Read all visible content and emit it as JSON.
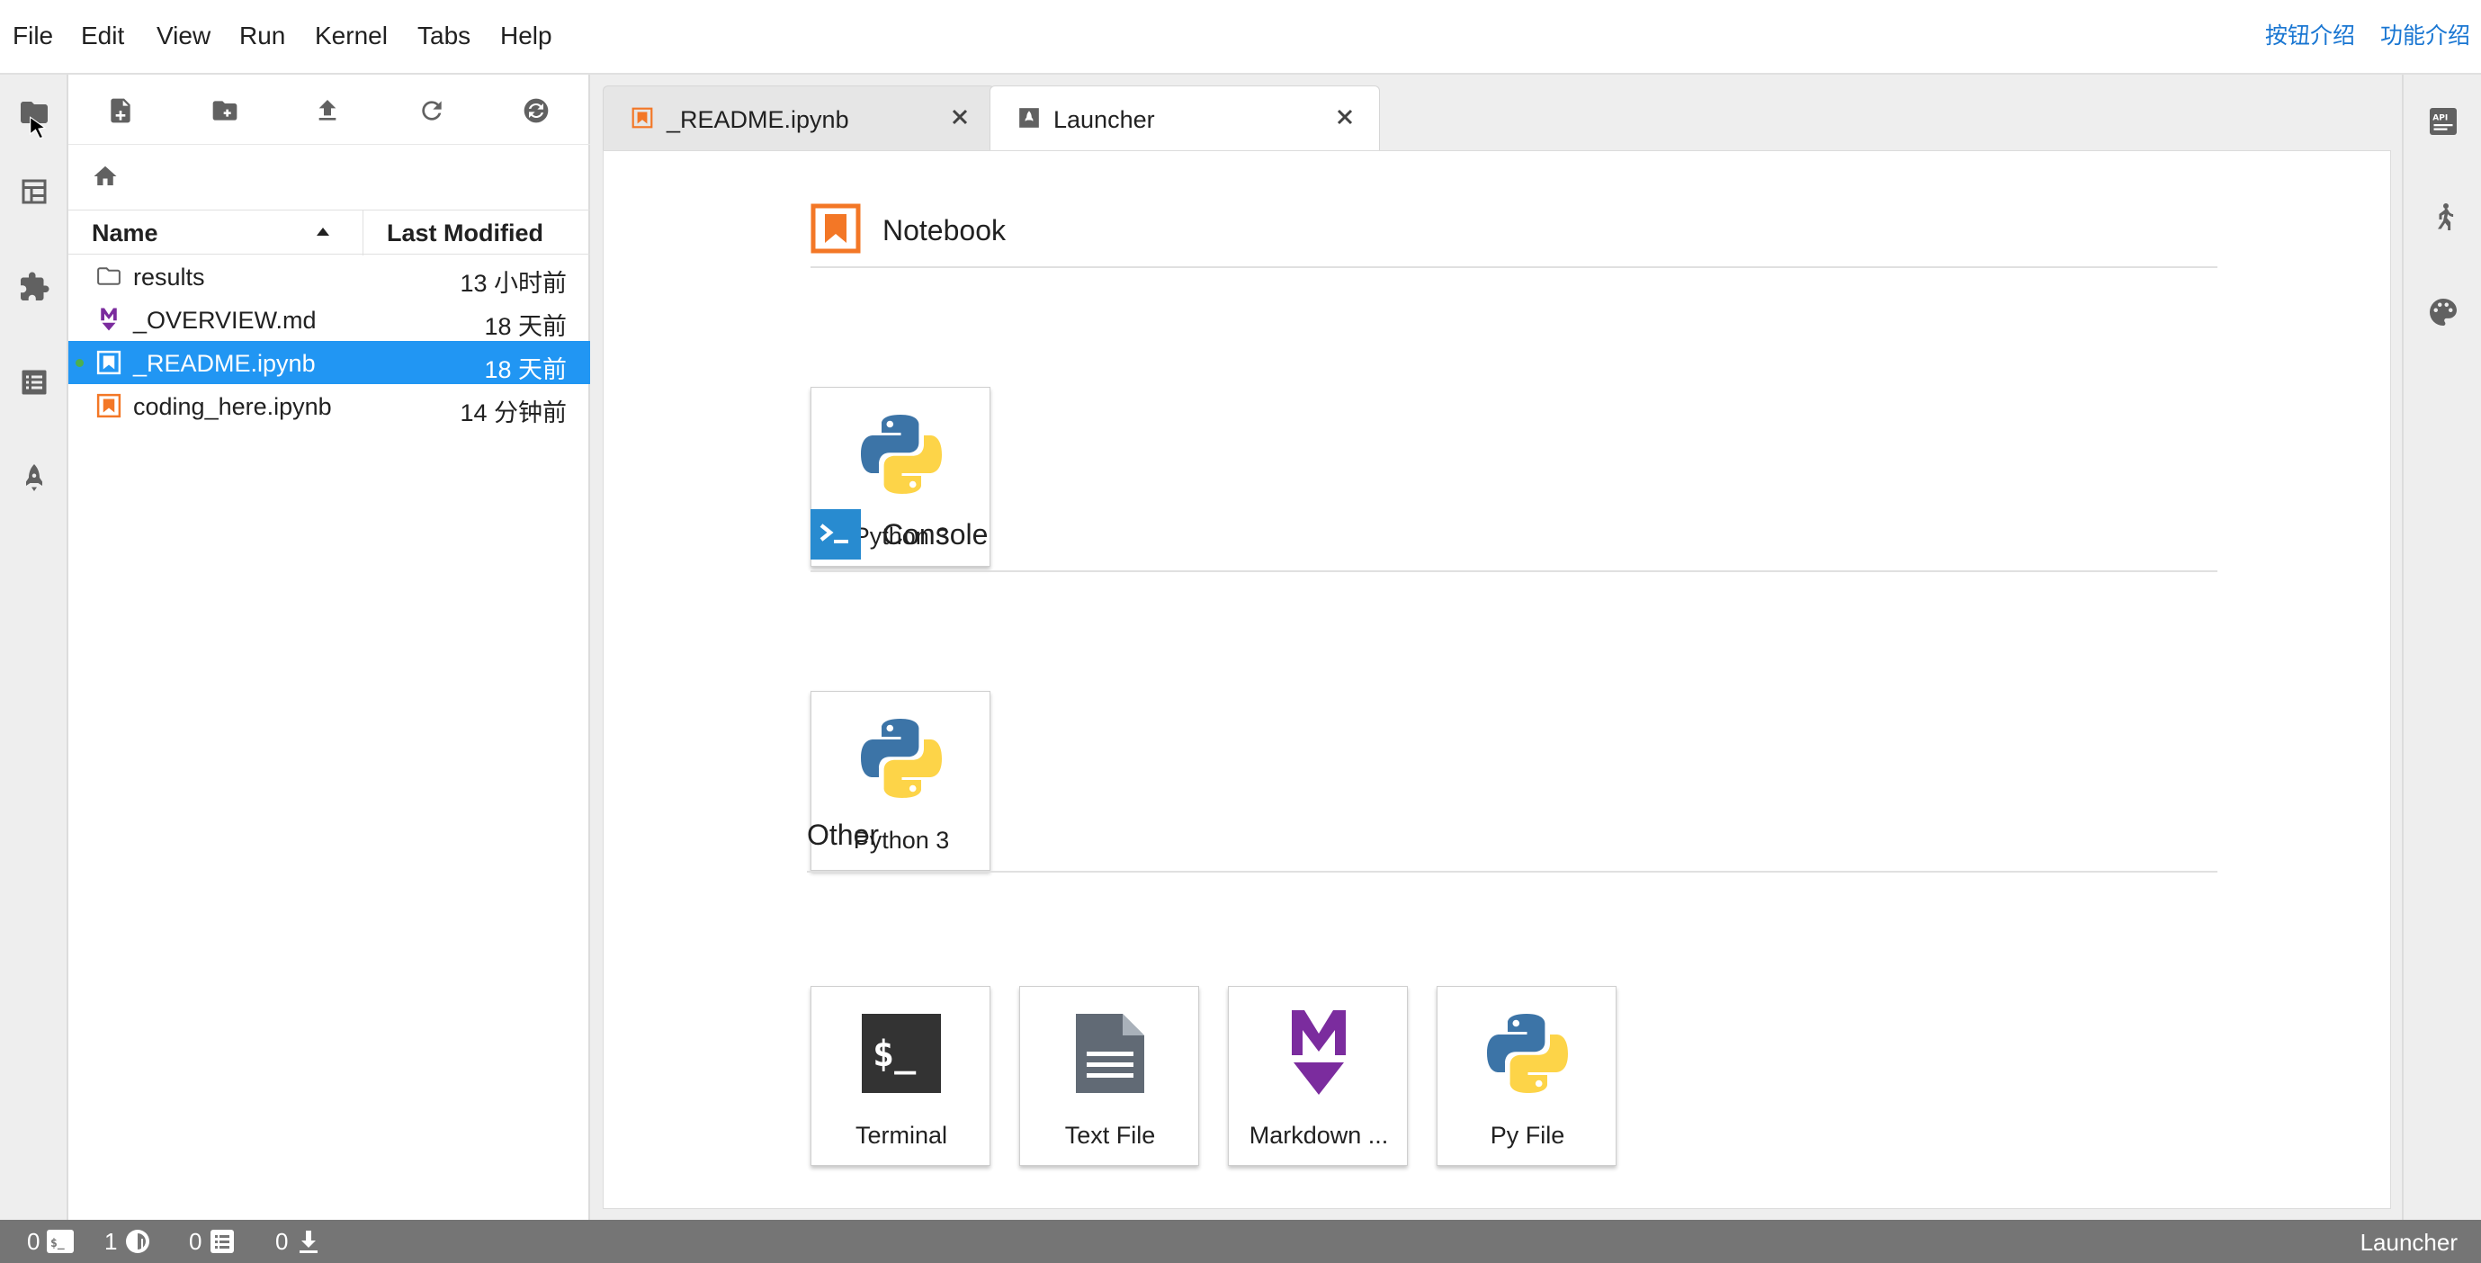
{
  "menubar": {
    "items": [
      "File",
      "Edit",
      "View",
      "Run",
      "Kernel",
      "Tabs",
      "Help"
    ],
    "links": [
      "按钮介绍",
      "功能介绍"
    ]
  },
  "left_sidebar": {
    "icons": [
      "folder-icon",
      "running-icon",
      "extension-icon",
      "toc-icon",
      "rocket-icon"
    ]
  },
  "file_browser": {
    "toolbar": [
      "new-launcher-icon",
      "new-folder-icon",
      "upload-icon",
      "refresh-icon",
      "sync-icon"
    ],
    "header": {
      "name": "Name",
      "modified": "Last Modified"
    },
    "files": [
      {
        "name": "results",
        "modified": "13 小时前",
        "type": "folder",
        "selected": false
      },
      {
        "name": "_OVERVIEW.md",
        "modified": "18 天前",
        "type": "markdown",
        "selected": false
      },
      {
        "name": "_README.ipynb",
        "modified": "18 天前",
        "type": "notebook",
        "selected": true,
        "running": true
      },
      {
        "name": "coding_here.ipynb",
        "modified": "14 分钟前",
        "type": "notebook",
        "selected": false
      }
    ]
  },
  "tabs": [
    {
      "label": "_README.ipynb",
      "active": false
    },
    {
      "label": "Launcher",
      "active": true
    }
  ],
  "launcher": {
    "sections": [
      {
        "title": "Notebook",
        "cards": [
          "Python 3"
        ]
      },
      {
        "title": "Console",
        "cards": [
          "Python 3"
        ]
      },
      {
        "title": "Other",
        "cards": [
          "Terminal",
          "Text File",
          "Markdown ...",
          "Py File"
        ]
      }
    ]
  },
  "right_sidebar": {
    "icons": [
      "api-icon",
      "runner-icon",
      "palette-icon"
    ]
  },
  "statusbar": {
    "terminals": "0",
    "kernels": "1",
    "consoles": "0",
    "downloads": "0",
    "mode": "Launcher"
  },
  "colors": {
    "accent": "#2196f3",
    "notebook_orange": "#f37726",
    "markdown_purple": "#7b2c9e",
    "console_blue": "#288bd0",
    "statusbar": "#757575",
    "link": "#1976d2"
  }
}
